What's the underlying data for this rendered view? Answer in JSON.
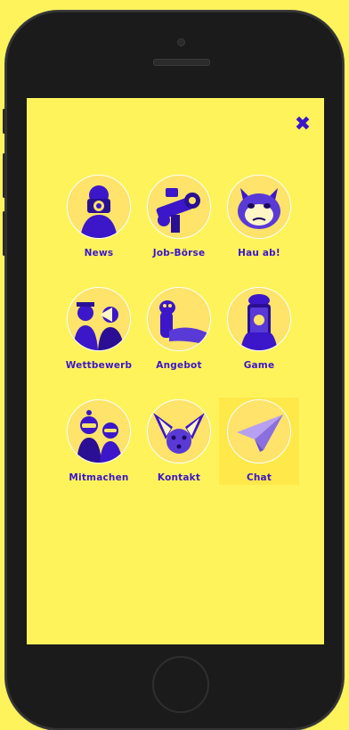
{
  "colors": {
    "background": "#FFF35C",
    "accent": "#3B17C9",
    "device": "#1b1b1b"
  },
  "menu": {
    "close_icon": "close-icon",
    "items": [
      {
        "label": "News",
        "icon": "photographer-icon"
      },
      {
        "label": "Job-Börse",
        "icon": "camera-crane-icon"
      },
      {
        "label": "Hau ab!",
        "icon": "grumpy-cat-icon"
      },
      {
        "label": "Wettbewerb",
        "icon": "people-megaphone-icon"
      },
      {
        "label": "Angebot",
        "icon": "ferret-icon"
      },
      {
        "label": "Game",
        "icon": "smartphone-icon"
      },
      {
        "label": "Mitmachen",
        "icon": "kids-party-icon"
      },
      {
        "label": "Kontakt",
        "icon": "fennec-fox-icon"
      },
      {
        "label": "Chat",
        "icon": "paper-plane-icon"
      }
    ]
  }
}
